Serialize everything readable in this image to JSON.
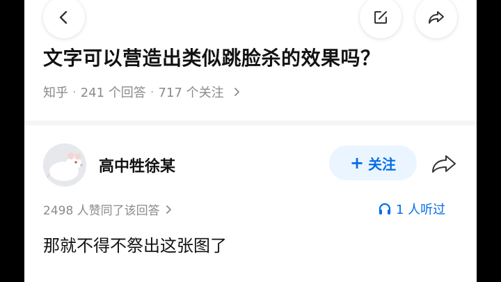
{
  "question": {
    "title": "文字可以营造出类似跳脸杀的效果吗？",
    "source": "知乎",
    "answer_count": "241 个回答",
    "follower_count": "717 个关注"
  },
  "answer": {
    "author_name": "高中牲徐某",
    "follow_label": "关注",
    "votes_text": "2498 人赞同了该回答",
    "listen_text": "1 人听过",
    "body_text": "那就不得不祭出这张图了"
  },
  "icons": {
    "back": "chevron-left-icon",
    "edit": "edit-icon",
    "share": "share-icon",
    "headphones": "headphones-icon",
    "avatar": "white-mouse-avatar"
  },
  "colors": {
    "accent": "#056de8",
    "follow_bg": "#ebf5ff",
    "text_primary": "#121212",
    "text_secondary": "#8a8a8a",
    "divider": "#f4f5f7"
  }
}
